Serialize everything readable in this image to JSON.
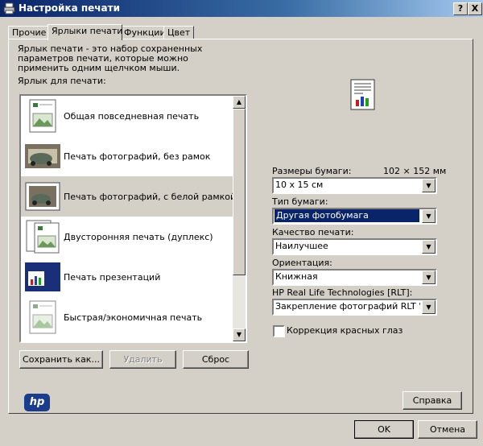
{
  "window": {
    "title": "Настройка печати",
    "help_glyph": "?",
    "close_glyph": "X"
  },
  "tabs": [
    {
      "label": "Прочие"
    },
    {
      "label": "Ярлыки печати"
    },
    {
      "label": "Функции"
    },
    {
      "label": "Цвет"
    }
  ],
  "shortcuts": {
    "description": "Ярлык печати - это набор сохраненных параметров печати, которые можно применить одним щелчком мыши.",
    "list_label": "Ярлык для печати:",
    "items": [
      {
        "label": "Общая повседневная печать",
        "icon": "document-icon"
      },
      {
        "label": "Печать фотографий, без рамок",
        "icon": "photo-borderless-icon"
      },
      {
        "label": "Печать фотографий, с белой рамкой",
        "icon": "photo-white-border-icon",
        "selected": true
      },
      {
        "label": "Двусторонняя печать (дуплекс)",
        "icon": "duplex-icon"
      },
      {
        "label": "Печать презентаций",
        "icon": "presentation-icon"
      },
      {
        "label": "Быстрая/экономичная печать",
        "icon": "economy-icon"
      }
    ],
    "buttons": {
      "save": "Сохранить как...",
      "delete": "Удалить",
      "reset": "Сброс"
    }
  },
  "settings": {
    "paper_size_label": "Размеры бумаги:",
    "paper_size_mm": "102 × 152 мм",
    "paper_size_value": "10 x 15 см",
    "paper_type_label": "Тип бумаги:",
    "paper_type_value": "Другая фотобумага",
    "quality_label": "Качество печати:",
    "quality_value": "Наилучшее",
    "orientation_label": "Ориентация:",
    "orientation_value": "Книжная",
    "rlt_label": "HP Real Life Technologies [RLT]:",
    "rlt_value": "Закрепление фотографий RLT 'Базо",
    "redeye_label": "Коррекция красных глаз",
    "redeye_checked": false
  },
  "footer": {
    "logo": "hp",
    "help": "Справка",
    "ok": "OK",
    "cancel": "Отмена"
  },
  "colors": {
    "titlebar": "#0a246a",
    "highlight": "#0a246a",
    "face": "#d4d0c8"
  }
}
